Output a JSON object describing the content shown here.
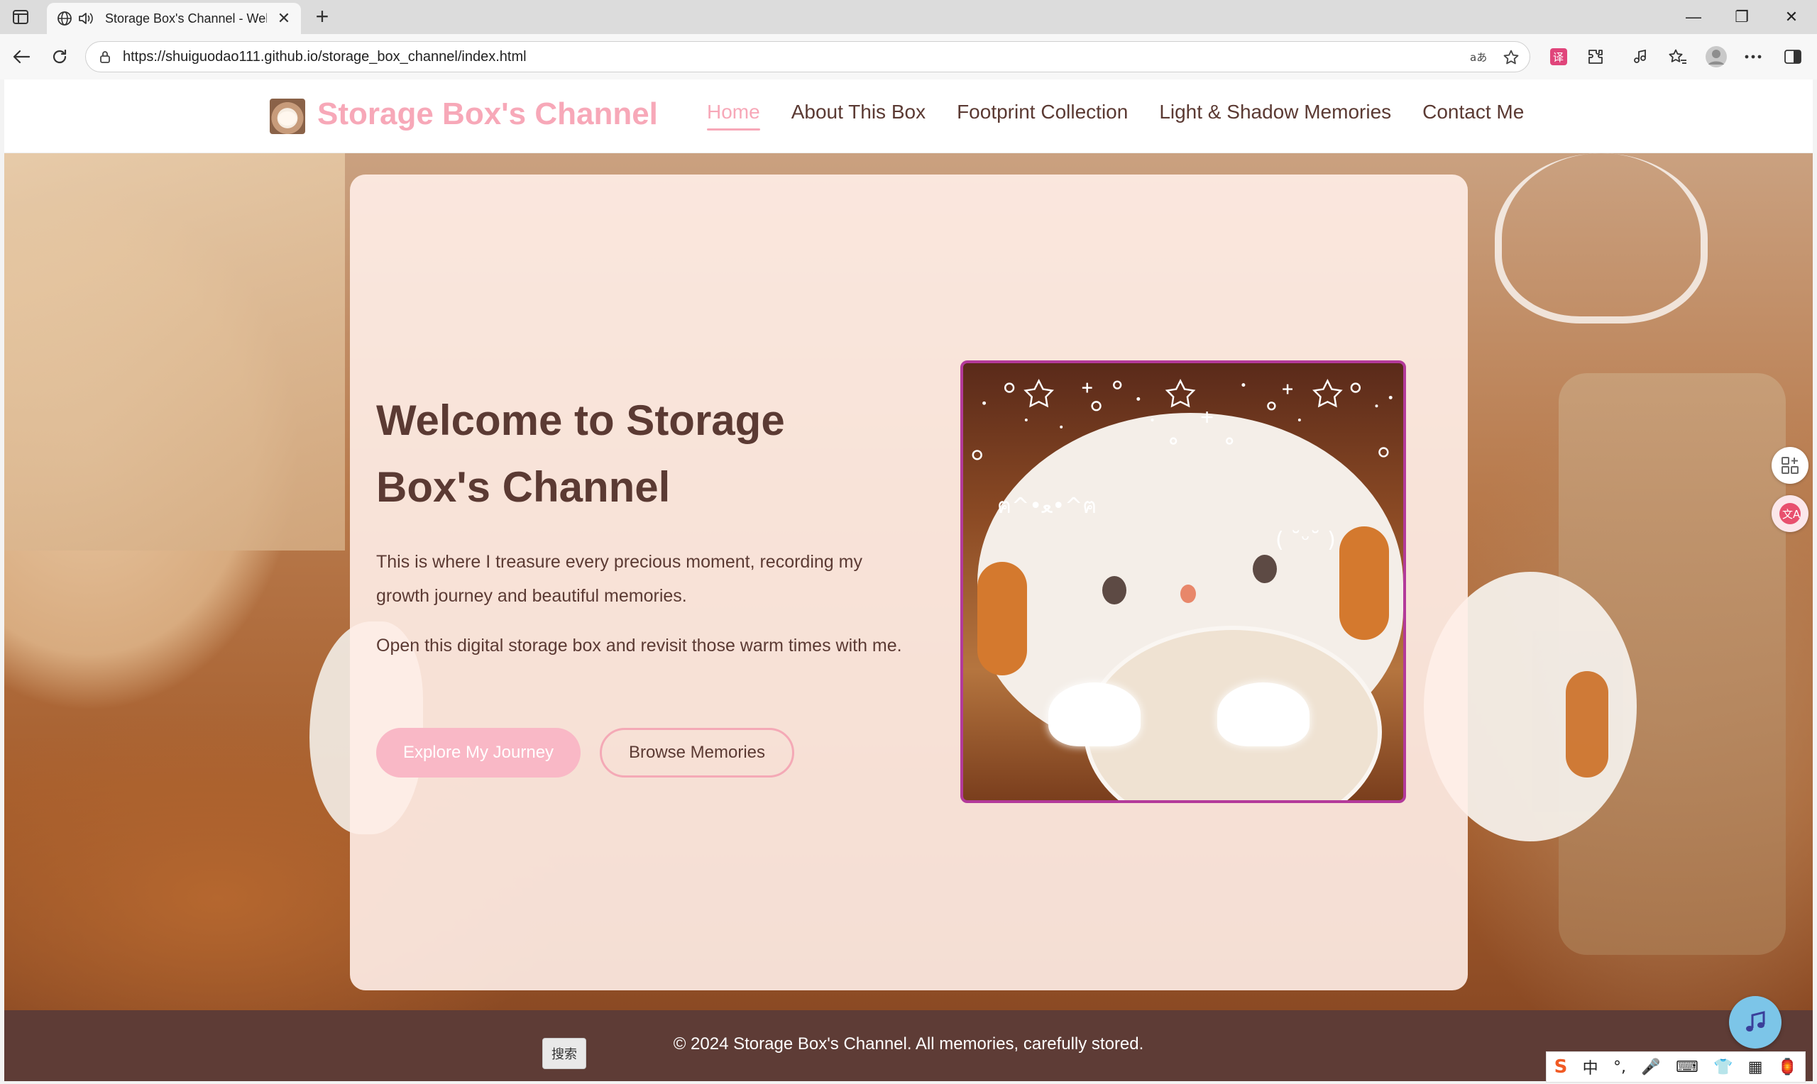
{
  "browser": {
    "tab_title": "Storage Box's Channel - Welcome",
    "url": "https://shuiguodao111.github.io/storage_box_channel/index.html",
    "new_tab_symbol": "+",
    "close_symbol": "✕",
    "minimize_symbol": "—",
    "restore_symbol": "❐",
    "window_close_symbol": "✕"
  },
  "site": {
    "title": "Storage Box's Channel",
    "nav": [
      "Home",
      "About This Box",
      "Footprint Collection",
      "Light & Shadow Memories",
      "Contact Me"
    ],
    "active_nav": "Home"
  },
  "hero": {
    "title": "Welcome to Storage Box's Channel",
    "paragraph_1": "This is where I treasure every precious moment, recording my growth journey and beautiful memories.",
    "paragraph_2": "Open this digital storage box and revisit those warm times with me.",
    "primary_button": "Explore My Journey",
    "secondary_button": "Browse Memories",
    "image_overlay_text_left": "ฅ^•ﻌ•^ฅ",
    "image_overlay_text_right": "( ˘ᵕ˘ )"
  },
  "footer": {
    "text": "© 2024 Storage Box's Channel. All memories, carefully stored."
  },
  "overlays": {
    "search_button": "搜索",
    "ime_items": [
      "S",
      "中",
      "°,",
      "🎤",
      "⌨",
      "👕",
      "▦",
      "🏮"
    ]
  },
  "colors": {
    "brand_pink": "#f7a8b8",
    "text_brown": "#5b3a33",
    "footer_bg": "#5e3c36",
    "image_border": "#b33a9a",
    "music_button": "#7cc5e8"
  },
  "icons": {
    "sidebar": "sidebar-toggle-icon",
    "globe": "globe-icon",
    "speaker": "speaker-icon",
    "back": "back-arrow-icon",
    "refresh": "refresh-icon",
    "lock": "lock-icon",
    "read_aloud": "read-aloud-icon",
    "favorite": "star-icon",
    "extensions": "puzzle-icon",
    "music": "music-note-icon"
  }
}
